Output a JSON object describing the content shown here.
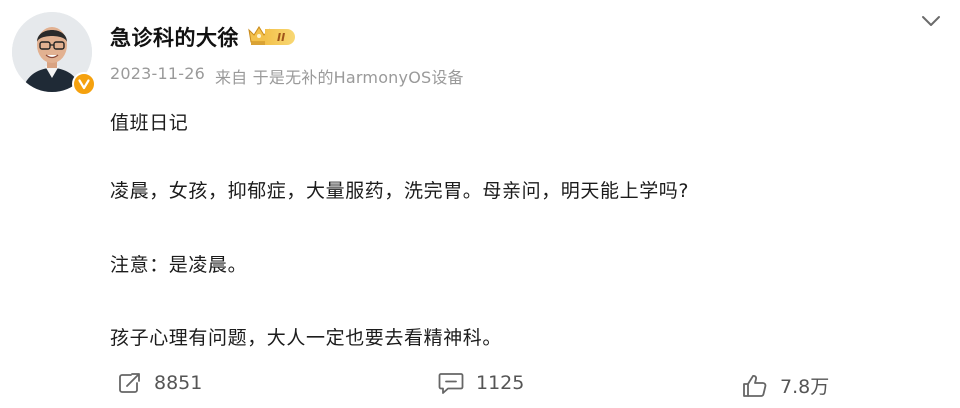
{
  "user": {
    "name": "急诊科的大徐",
    "level_badge": "II"
  },
  "meta": {
    "date": "2023-11-26",
    "source": "来自 于是无补的HarmonyOS设备"
  },
  "content": {
    "lines": [
      "值班日记",
      "凌晨，女孩，抑郁症，大量服药，洗完胃。母亲问，明天能上学吗?",
      "注意：是凌晨。",
      "孩子心理有问题，大人一定也要去看精神科。"
    ]
  },
  "actions": {
    "repost_count": "8851",
    "comment_count": "1125",
    "like_count": "7.8万"
  },
  "colors": {
    "verified": "#f5a10e",
    "meta_text": "#9a9a9a",
    "crown_gold": "#f3c14b"
  },
  "icons": {
    "menu": "chevron-down-icon",
    "repost": "repost-icon",
    "comment": "comment-icon",
    "like": "thumbs-up-icon",
    "verified": "verified-v-icon",
    "crown": "crown-icon"
  }
}
